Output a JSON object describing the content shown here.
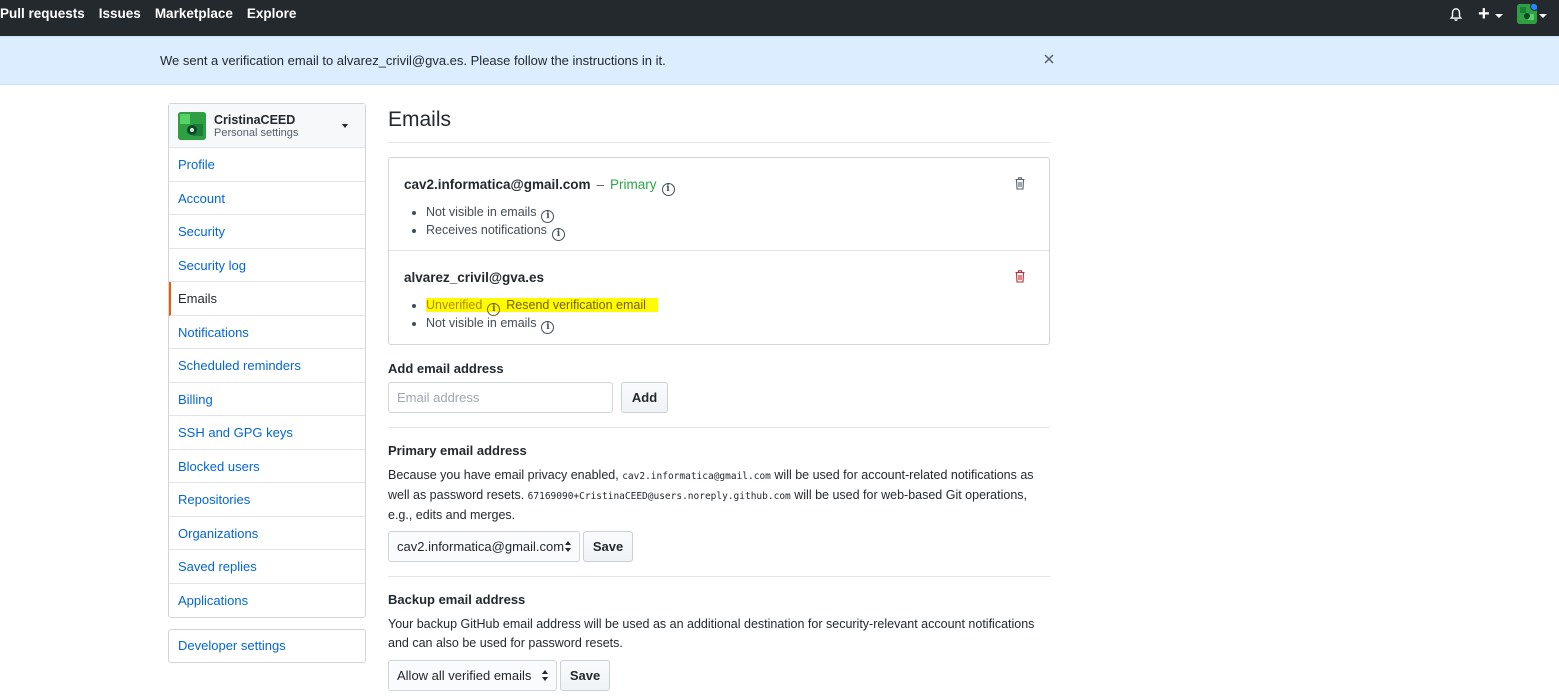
{
  "nav": {
    "links": [
      "Pull requests",
      "Issues",
      "Marketplace",
      "Explore"
    ],
    "icons": [
      "bell-icon",
      "plus-icon",
      "avatar"
    ]
  },
  "flash": {
    "message": "We sent a verification email to alvarez_crivil@gva.es. Please follow the instructions in it."
  },
  "sidebar": {
    "username": "CristinaCEED",
    "subtitle": "Personal settings",
    "items": [
      {
        "label": "Profile"
      },
      {
        "label": "Account"
      },
      {
        "label": "Security"
      },
      {
        "label": "Security log"
      },
      {
        "label": "Emails",
        "selected": true
      },
      {
        "label": "Notifications"
      },
      {
        "label": "Scheduled reminders"
      },
      {
        "label": "Billing"
      },
      {
        "label": "SSH and GPG keys"
      },
      {
        "label": "Blocked users"
      },
      {
        "label": "Repositories"
      },
      {
        "label": "Organizations"
      },
      {
        "label": "Saved replies"
      },
      {
        "label": "Applications"
      }
    ],
    "developer_settings": "Developer settings"
  },
  "main": {
    "title": "Emails",
    "emails": [
      {
        "address": "cav2.informatica@gmail.com",
        "dash": "–",
        "badge": "Primary",
        "bullets": [
          "Not visible in emails",
          "Receives notifications"
        ]
      },
      {
        "address": "alvarez_crivil@gva.es",
        "unverified": "Unverified",
        "resend": "Resend verification email",
        "bullets": [
          "Not visible in emails"
        ]
      }
    ],
    "add_email": {
      "label": "Add email address",
      "placeholder": "Email address",
      "button": "Add"
    },
    "primary_email": {
      "label": "Primary email address",
      "text_1": "Because you have email privacy enabled,",
      "code_1": "cav2.informatica@gmail.com",
      "text_2": "will be used for account-related notifications as well as password resets.",
      "code_2": "67169090+CristinaCEED@users.noreply.github.com",
      "text_3": "will be used for web-based Git operations, e.g., edits and merges.",
      "selected": "cav2.informatica@gmail.com",
      "button": "Save"
    },
    "backup_email": {
      "label": "Backup email address",
      "text": "Your backup GitHub email address will be used as an additional destination for security-relevant account notifications and can also be used for password resets.",
      "selected": "Allow all verified emails",
      "button": "Save"
    }
  },
  "colors": {
    "header_bg": "#24292e",
    "flash_bg": "#dbedff",
    "link": "#0366d6",
    "primary_green": "#28a745",
    "highlight": "#fffb00",
    "delete_red": "#cb2431",
    "selected_accent": "#e36209"
  }
}
